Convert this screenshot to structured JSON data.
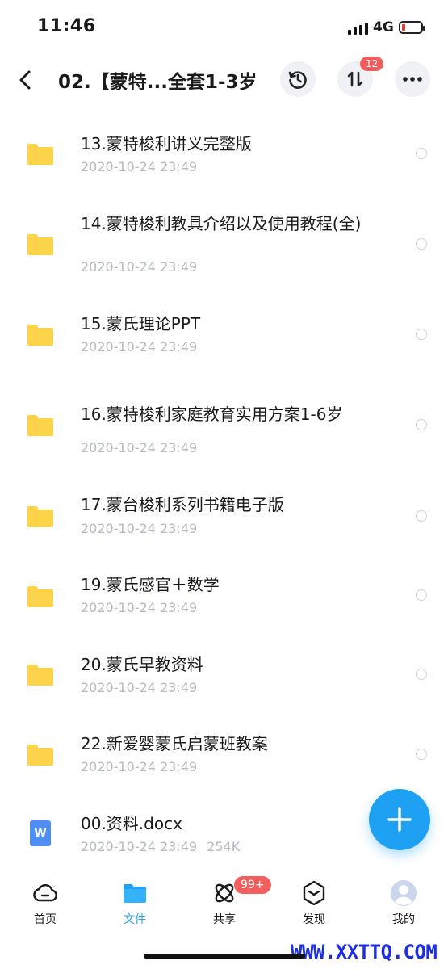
{
  "status": {
    "time": "11:46",
    "network": "4G"
  },
  "header": {
    "title": "02.【蒙特...全套1-3岁",
    "transfer_badge": "12"
  },
  "files": [
    {
      "name": "13.蒙特梭利讲义完整版",
      "date": "2020-10-24 23:49",
      "type": "folder"
    },
    {
      "name": "14.蒙特梭利教具介绍以及使用教程(全)",
      "date": "2020-10-24 23:49",
      "type": "folder"
    },
    {
      "name": "15.蒙氏理论PPT",
      "date": "2020-10-24 23:49",
      "type": "folder"
    },
    {
      "name": "16.蒙特梭利家庭教育实用方案1-6岁",
      "date": "2020-10-24 23:49",
      "type": "folder"
    },
    {
      "name": "17.蒙台梭利系列书籍电子版",
      "date": "2020-10-24 23:49",
      "type": "folder"
    },
    {
      "name": "19.蒙氏感官＋数学",
      "date": "2020-10-24 23:49",
      "type": "folder"
    },
    {
      "name": "20.蒙氏早教资料",
      "date": "2020-10-24 23:49",
      "type": "folder"
    },
    {
      "name": "22.新爱婴蒙氏启蒙班教案",
      "date": "2020-10-24 23:49",
      "type": "folder"
    },
    {
      "name": "00.资料.docx",
      "date": "2020-10-24 23:49",
      "size": "254K",
      "type": "docx",
      "icon_letter": "W"
    }
  ],
  "tabbar": {
    "home": "首页",
    "files": "文件",
    "share": "共享",
    "share_badge": "99+",
    "discover": "发现",
    "me": "我的"
  },
  "watermark": "WWW.XXTTQ.COM",
  "colors": {
    "accent": "#1ea1f3",
    "folder": "#fcd349",
    "badge": "#f25d5d",
    "meta": "#b7bac1"
  }
}
